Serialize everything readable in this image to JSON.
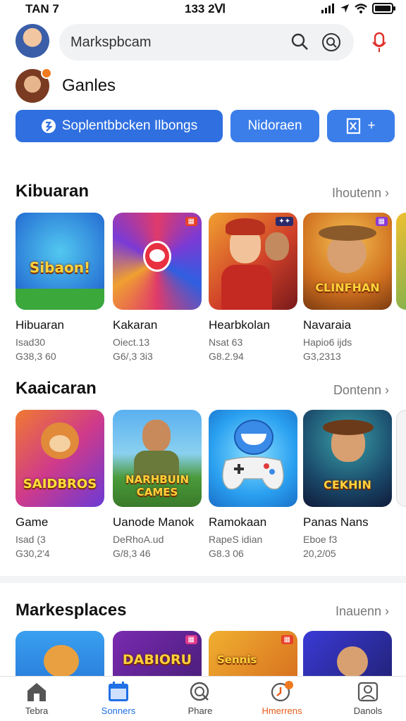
{
  "status": {
    "time_left": "TAN 7",
    "time_center": "133 2Ⅵ",
    "signal_icon": "signal-icon",
    "wifi_icon": "wifi-icon",
    "battery_icon": "battery-icon"
  },
  "header": {
    "search_placeholder": "Markspbcam",
    "games_title": "Ganles",
    "pills": [
      "Soplentbbcken  Ilbongs",
      "Nidoraen",
      "+"
    ]
  },
  "sections": [
    {
      "title": "Kibuaran",
      "more": "Ihoutenn ›",
      "cards": [
        {
          "tile_text": "Sibaon!",
          "name": "Hibuaran",
          "meta1": "Isad30",
          "meta2": "G38,3 60"
        },
        {
          "tile_text": "",
          "name": "Kakaran",
          "meta1": "Oiect.13",
          "meta2": "G6/,3 3i3"
        },
        {
          "tile_text": "",
          "name": "Hearbkolan",
          "meta1": "Nsat 63",
          "meta2": "G8.2.94"
        },
        {
          "tile_text": "CLINFHAN",
          "name": "Navaraia",
          "meta1": "Hapio6 ijds",
          "meta2": "G3,2313"
        }
      ]
    },
    {
      "title": "Kaaicaran",
      "more": "Dontenn ›",
      "cards": [
        {
          "tile_text": "SAIDBROS",
          "name": "Game",
          "meta1": "Isad (3",
          "meta2": "G30,2'4"
        },
        {
          "tile_text": "NARHBUIN CAMES",
          "name": "Uanode Manok",
          "meta1": "DeRhoA.ud",
          "meta2": "G/8,3 46"
        },
        {
          "tile_text": "",
          "name": "Ramokaan",
          "meta1": "RapeS  idian",
          "meta2": "G8.3 06"
        },
        {
          "tile_text": "CEKHIN",
          "name": "Panas Nans",
          "meta1": "Eboe f3",
          "meta2": "20,2/05"
        }
      ]
    },
    {
      "title": "Markesplaces",
      "more": "Inauenn ›",
      "cards": [
        {
          "tile_text": "",
          "name": "",
          "meta1": "",
          "meta2": ""
        },
        {
          "tile_text": "DABIORU",
          "name": "",
          "meta1": "",
          "meta2": ""
        },
        {
          "tile_text": "Sennis",
          "name": "",
          "meta1": "",
          "meta2": ""
        },
        {
          "tile_text": "",
          "name": "",
          "meta1": "",
          "meta2": ""
        }
      ]
    }
  ],
  "nav": [
    {
      "label": "Tebra",
      "icon": "home-icon"
    },
    {
      "label": "Sonners",
      "icon": "calendar-icon"
    },
    {
      "label": "Phare",
      "icon": "search-icon"
    },
    {
      "label": "Hmerrens",
      "icon": "clock-icon"
    },
    {
      "label": "Danols",
      "icon": "profile-icon"
    }
  ],
  "colors": {
    "accent": "#2f6fe0",
    "active_nav": "#1f6fe5",
    "badge": "#f07a20"
  }
}
